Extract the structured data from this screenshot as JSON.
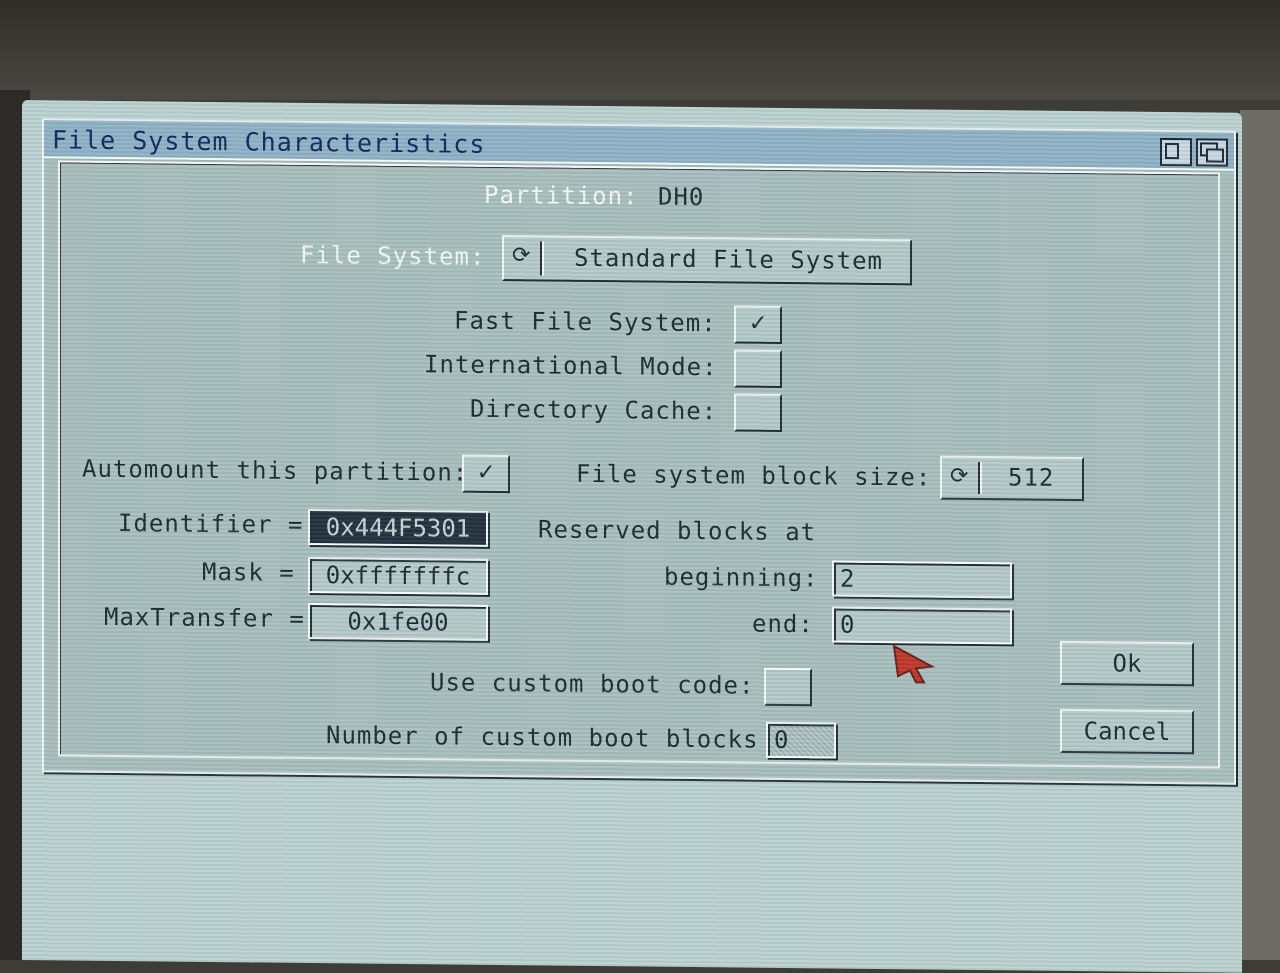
{
  "window": {
    "title": "File System Characteristics"
  },
  "partition": {
    "label": "Partition:",
    "value": "DH0"
  },
  "file_system": {
    "label": "File System:",
    "value": "Standard File System"
  },
  "options": {
    "fast_file_system": {
      "label": "Fast File System:",
      "checked": true,
      "mark": "✓"
    },
    "international_mode": {
      "label": "International Mode:",
      "checked": false
    },
    "directory_cache": {
      "label": "Directory Cache:",
      "checked": false
    }
  },
  "automount": {
    "label": "Automount this partition:",
    "checked": true,
    "mark": "✓"
  },
  "block_size": {
    "label": "File system block size:",
    "value": "512"
  },
  "identifier": {
    "label": "Identifier =",
    "value": "0x444F5301"
  },
  "mask": {
    "label": "Mask =",
    "value": "0xfffffffc"
  },
  "max_transfer": {
    "label": "MaxTransfer =",
    "value": "0x1fe00"
  },
  "reserved": {
    "heading": "Reserved blocks at",
    "beginning_label": "beginning:",
    "beginning_value": "2",
    "end_label": "end:",
    "end_value": "0"
  },
  "custom_boot_code": {
    "label": "Use custom boot code:",
    "checked": false
  },
  "custom_boot_blocks": {
    "label": "Number of custom boot blocks",
    "value": "0"
  },
  "buttons": {
    "ok": "Ok",
    "cancel": "Cancel"
  },
  "colors": {
    "screen": "#bcd3d1",
    "titlebar": "#8fb3c6",
    "pointer": "#c0392b"
  }
}
